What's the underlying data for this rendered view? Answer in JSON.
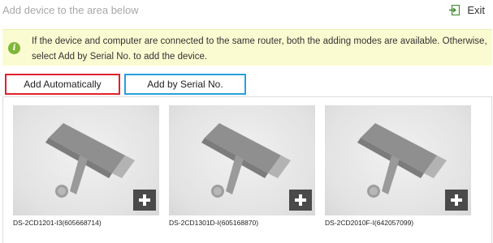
{
  "header": {
    "title": "Add device to the area below",
    "exit_label": "Exit"
  },
  "notice": {
    "icon": "info-icon",
    "text": "If the device and computer are connected to the same router, both the adding modes are available. Otherwise, select Add by Serial No. to add the device."
  },
  "modes": {
    "auto_label": "Add Automatically",
    "serial_label": "Add by Serial No."
  },
  "colors": {
    "auto_border": "#e2202b",
    "serial_border": "#2aa0dd",
    "notice_bg": "#fbfbd2",
    "info_icon": "#7fb63a"
  },
  "devices": [
    {
      "label": "DS-2CD1201-I3(605668714)"
    },
    {
      "label": "DS-2CD1301D-I(605168870)"
    },
    {
      "label": "DS-2CD2010F-I(642057099)"
    }
  ]
}
